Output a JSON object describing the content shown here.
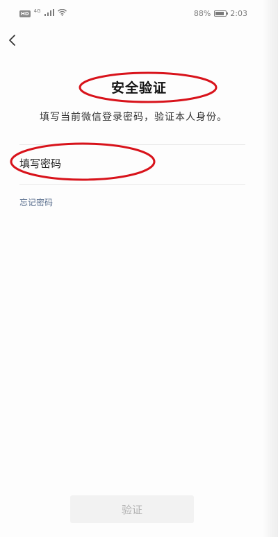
{
  "status_bar": {
    "network_badge": "HD",
    "network_type": "4G",
    "battery_percent": "88%",
    "battery_level": 0.88,
    "time": "2:03",
    "icons": [
      "signal-icon",
      "wifi-icon",
      "battery-icon"
    ]
  },
  "nav": {
    "back_icon": "chevron-left-icon"
  },
  "page": {
    "title": "安全验证",
    "subtitle": "填写当前微信登录密码，验证本人身份。"
  },
  "password": {
    "placeholder": "填写密码"
  },
  "forgot_password_label": "忘记密码",
  "verify_button_label": "验证",
  "colors": {
    "annotation": "#d8131b",
    "link": "#5a6f8e",
    "button_disabled_bg": "#f2f2f2",
    "button_disabled_text": "#b4b4b4"
  }
}
